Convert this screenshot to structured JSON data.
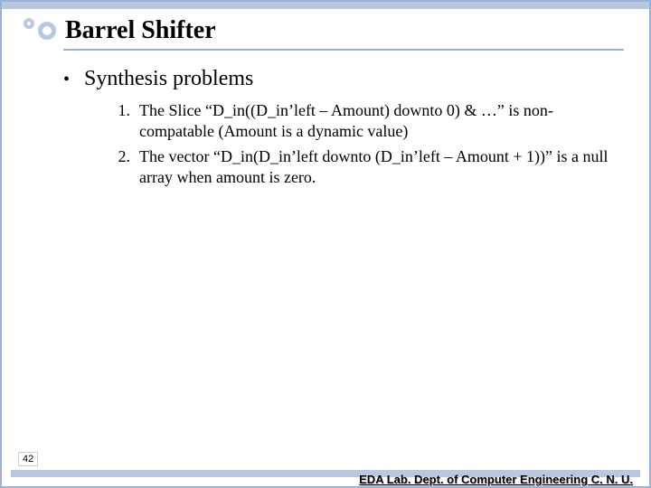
{
  "slide": {
    "title": "Barrel Shifter",
    "heading_bullet": "•",
    "heading": "Synthesis problems",
    "items": [
      {
        "num": "1.",
        "text": "The Slice “D_in((D_in’left – Amount) downto 0) & …” is non-compatable (Amount is a dynamic value)"
      },
      {
        "num": "2.",
        "text": "The vector “D_in(D_in’left downto (D_in’left – Amount + 1))” is a null array when amount is zero."
      }
    ],
    "page_number": "42",
    "footer": "EDA Lab. Dept. of Computer Engineering C. N. U."
  }
}
